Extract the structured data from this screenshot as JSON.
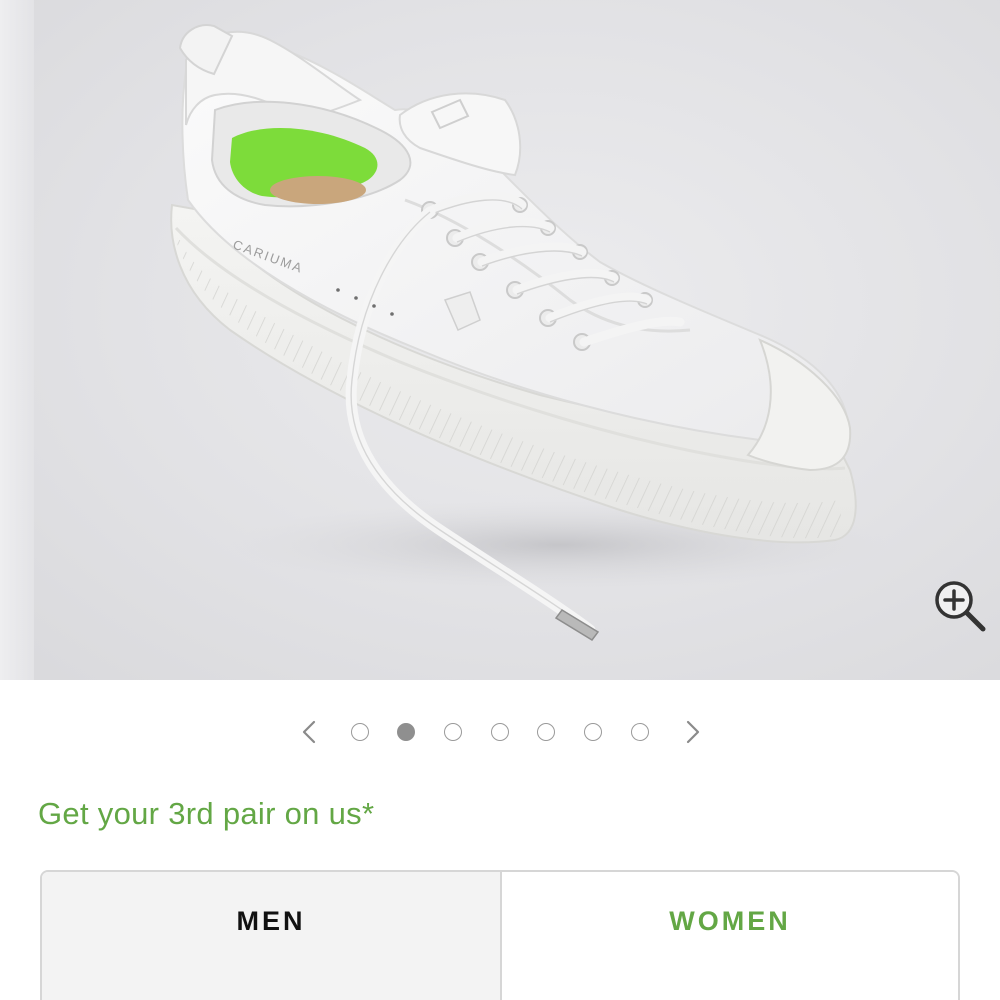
{
  "gallery": {
    "zoom_icon": "zoom-in-icon",
    "current_slide": 2,
    "slide_count": 7,
    "prev_icon": "chevron-left-icon",
    "next_icon": "chevron-right-icon"
  },
  "product_image": {
    "brand_text": "CARIUMA"
  },
  "promo": {
    "text": "Get your 3rd pair on us*"
  },
  "gender_tabs": {
    "men_label": "MEN",
    "women_label": "WOMEN",
    "selected": "WOMEN"
  },
  "colors": {
    "accent": "#63a745",
    "insole": "#7ddc3a",
    "dot_active": "#8f8f8f"
  }
}
